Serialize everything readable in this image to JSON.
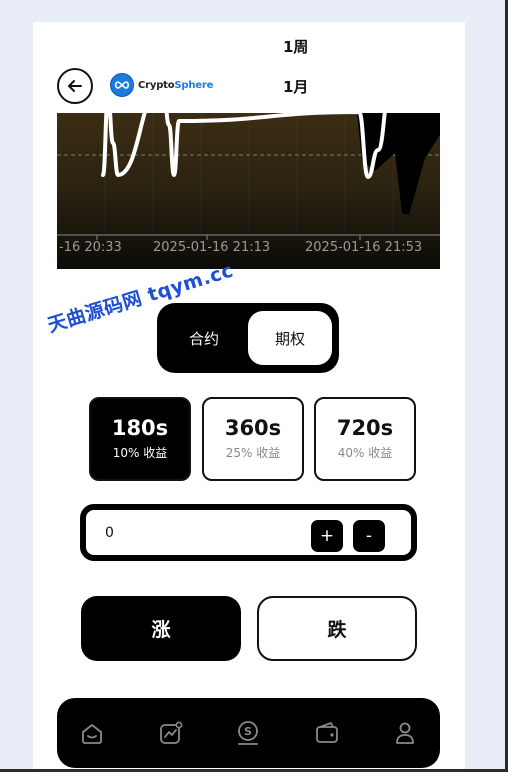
{
  "periods": [
    "1周",
    "1月"
  ],
  "brand": {
    "name_prefix": "Crypto",
    "name_suffix": "Sphere"
  },
  "chart_data": {
    "type": "line",
    "x_tick_labels": [
      "-16 20:33",
      "2025-01-16 21:13",
      "2025-01-16 21:53"
    ],
    "series": [
      {
        "values": [
          110,
          32,
          78,
          110,
          18,
          60,
          110,
          56,
          47,
          112,
          85,
          25,
          18,
          20
        ]
      }
    ],
    "reference_line": "dashed",
    "background": "dark-gradient",
    "colors": {
      "line": "#ffffff",
      "bg_top": "#3b2d13",
      "bg_bottom": "#0c0b08"
    }
  },
  "watermark": "天曲源码网 tqym.cc",
  "mode": {
    "contract_label": "合约",
    "option_label": "期权",
    "selected": "期权"
  },
  "durations": [
    {
      "time": "180s",
      "yield": "10% 收益",
      "active": true
    },
    {
      "time": "360s",
      "yield": "25% 收益",
      "active": false
    },
    {
      "time": "720s",
      "yield": "40% 收益",
      "active": false
    }
  ],
  "amount": {
    "value": "0",
    "plus": "+",
    "minus": "-"
  },
  "actions": {
    "up_label": "涨",
    "down_label": "跌"
  },
  "nav": [
    {
      "icon": "home-icon"
    },
    {
      "icon": "market-chart-icon"
    },
    {
      "icon": "trade-coin-icon"
    },
    {
      "icon": "wallet-icon"
    },
    {
      "icon": "profile-icon"
    }
  ],
  "colors": {
    "accent": "#000000",
    "brand_blue": "#1f7ae0",
    "watermark": "#1d4fd6"
  }
}
